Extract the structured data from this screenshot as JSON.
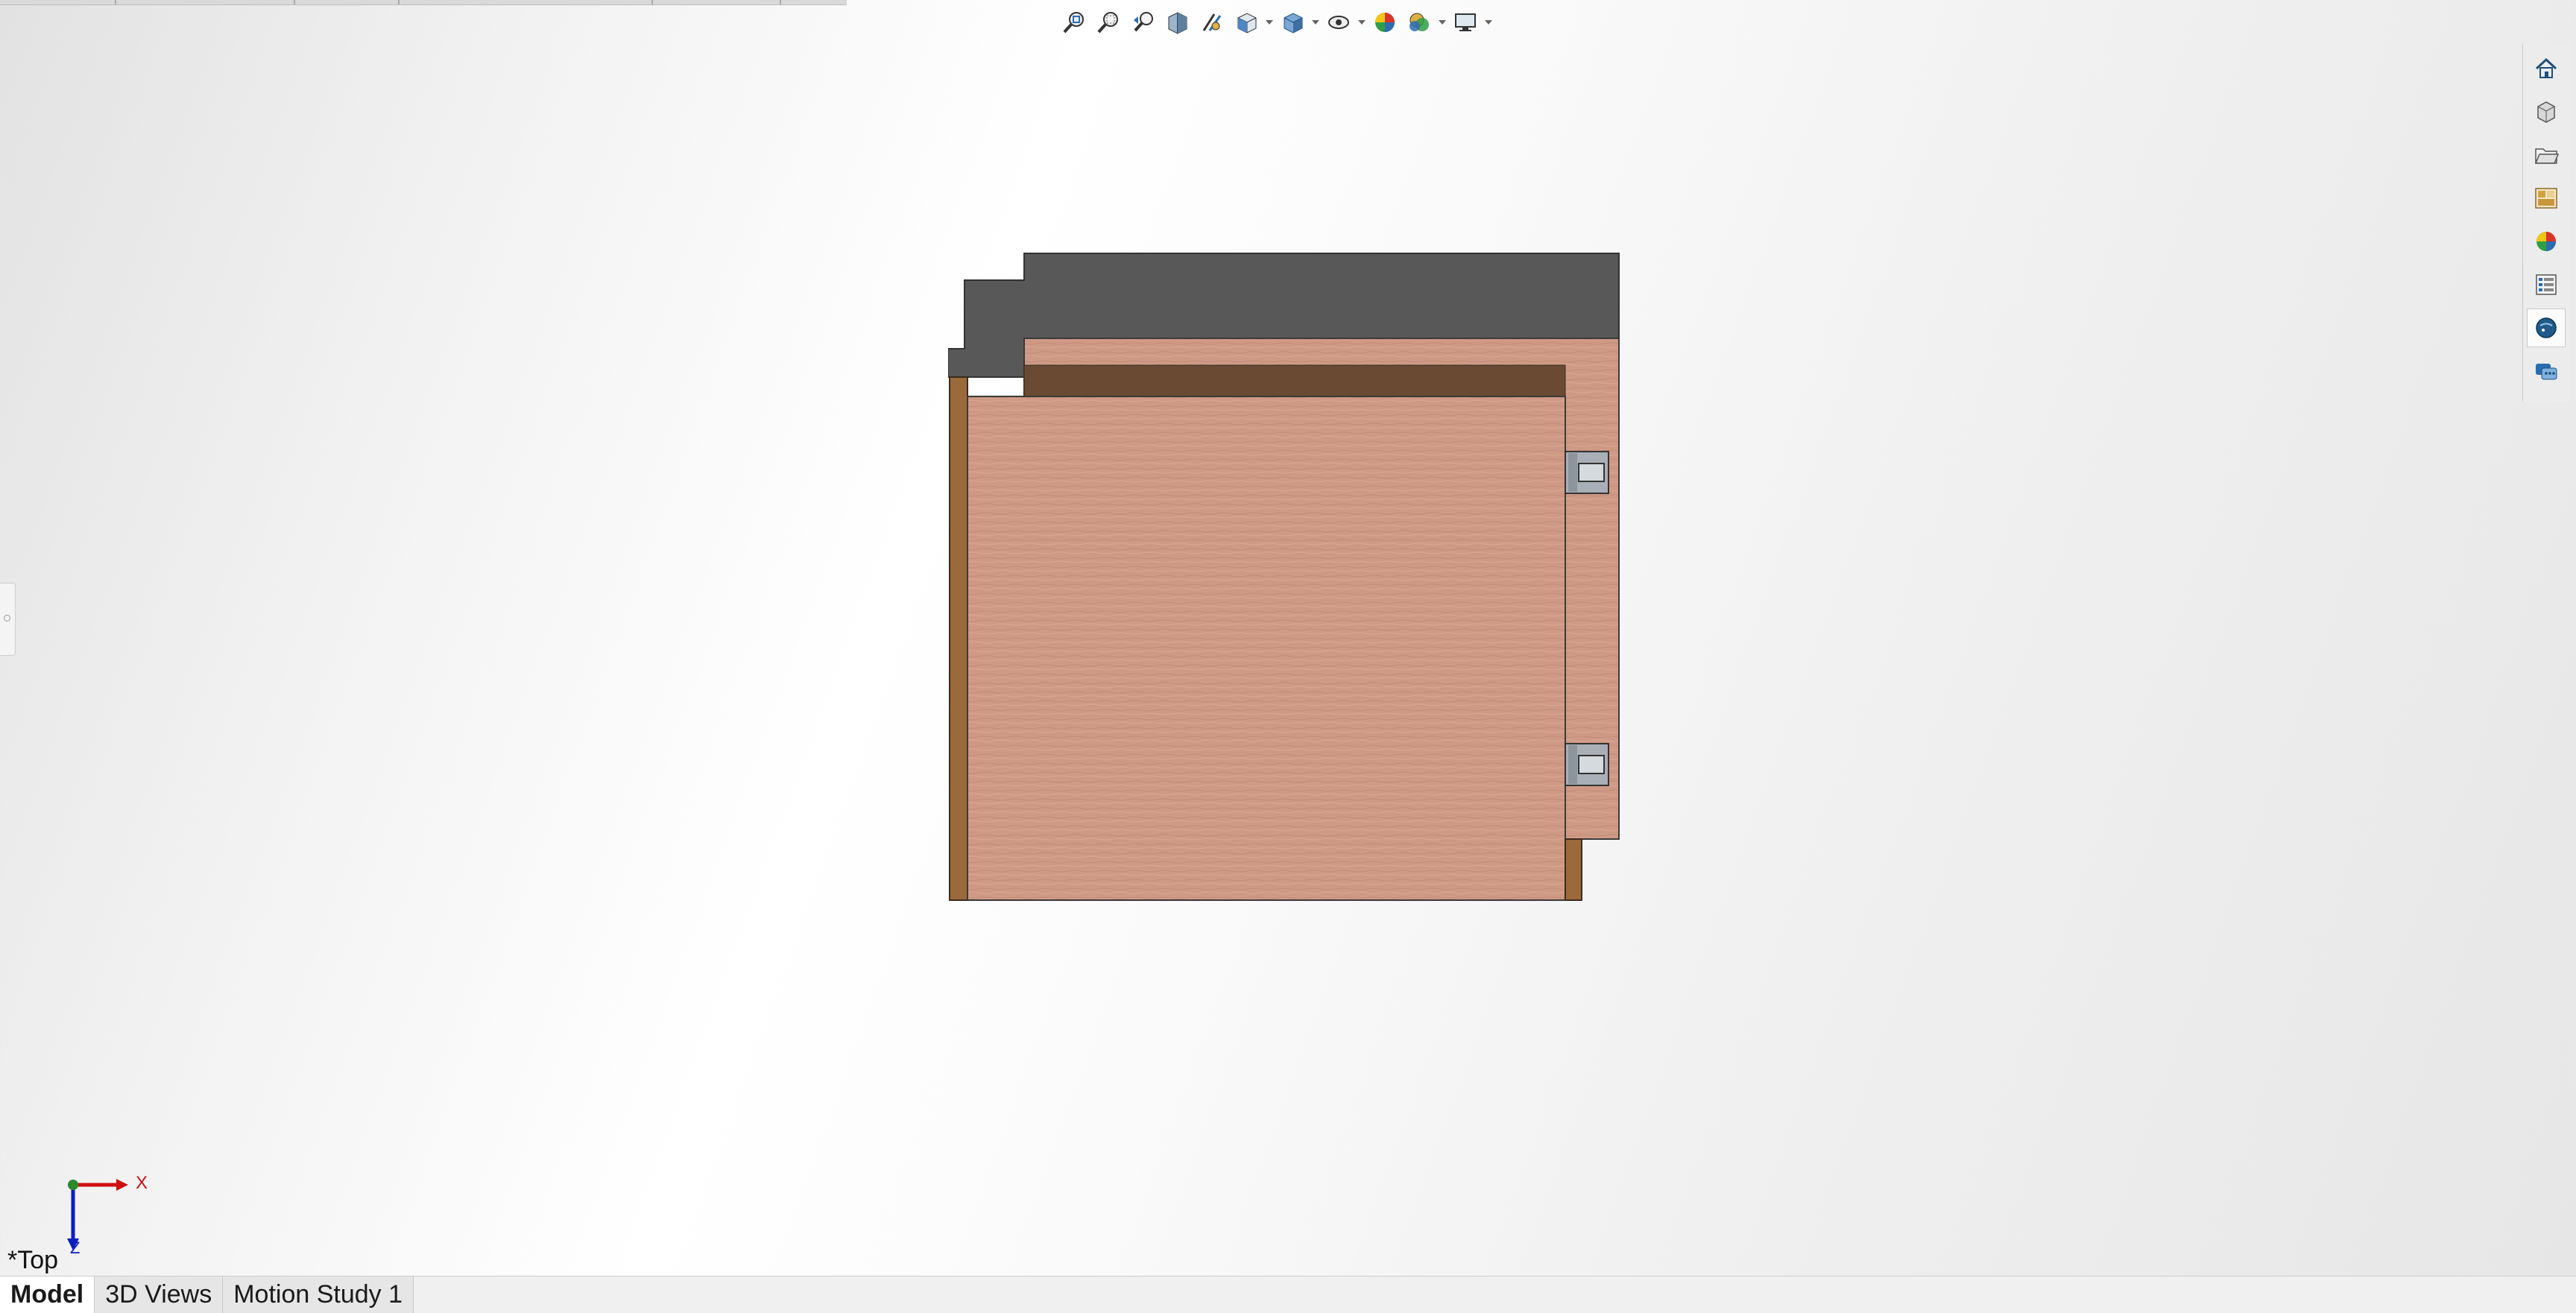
{
  "view": {
    "name": "*Top"
  },
  "axis_triad": {
    "x_label": "X",
    "z_label": "Z",
    "x_color": "#d01010",
    "z_color": "#0a1fbf",
    "y_color": "#2a8a2a"
  },
  "tabs": [
    {
      "label": "Model",
      "active": true
    },
    {
      "label": "3D Views",
      "active": false
    },
    {
      "label": "Motion Study 1",
      "active": false
    }
  ],
  "heads_up_toolbar": [
    "zoom-to-fit-icon",
    "zoom-to-area-icon",
    "previous-view-icon",
    "section-view-icon",
    "dynamic-annotation-icon",
    "view-orientation-icon",
    "display-style-icon",
    "hide-show-items-icon",
    "edit-appearance-icon",
    "apply-scene-icon",
    "view-settings-icon"
  ],
  "task_pane": [
    "home-icon",
    "3d-part-library-icon",
    "file-explorer-icon",
    "view-palette-icon",
    "appearances-scenes-icon",
    "custom-properties-icon",
    "3dexperience-marketplace-icon",
    "solidworks-forum-icon"
  ],
  "colors": {
    "wood": "#cf9a85",
    "wood_edge": "#9a6a3b",
    "dark_panel": "#585858",
    "shadow_strip": "#6b4a33",
    "hinge": "#a8afb6"
  }
}
